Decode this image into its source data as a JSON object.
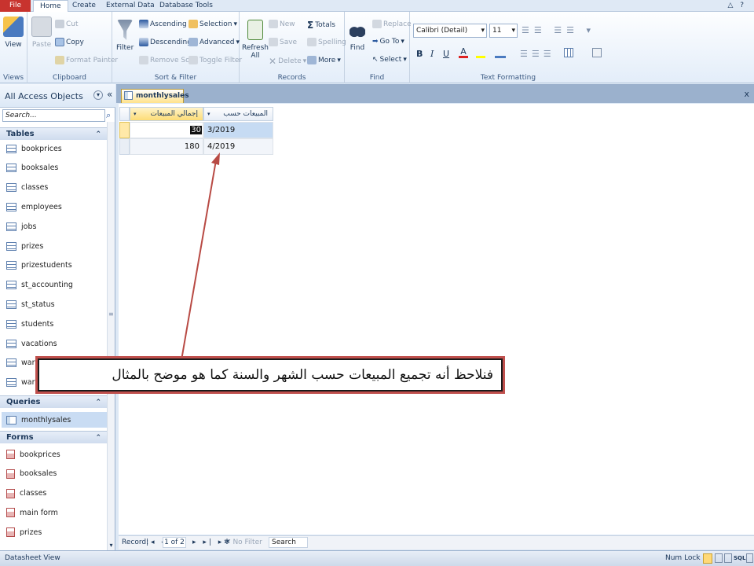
{
  "ribbon_tabs": [
    "File",
    "Home",
    "Create",
    "External Data",
    "Database Tools"
  ],
  "help_icons": "△ ?",
  "groups": {
    "views": {
      "label": "Views",
      "view": "View"
    },
    "clipboard": {
      "label": "Clipboard",
      "paste": "Paste",
      "cut": "Cut",
      "copy": "Copy",
      "format_painter": "Format Painter"
    },
    "sort_filter": {
      "label": "Sort & Filter",
      "filter": "Filter",
      "ascending": "Ascending",
      "descending": "Descending",
      "remove_sort": "Remove Sort",
      "selection": "Selection",
      "advanced": "Advanced",
      "toggle_filter": "Toggle Filter"
    },
    "records": {
      "label": "Records",
      "refresh": "Refresh All",
      "new": "New",
      "save": "Save",
      "delete": "Delete",
      "totals": "Totals",
      "spelling": "Spelling",
      "more": "More"
    },
    "find": {
      "label": "Find",
      "find": "Find",
      "replace": "Replace",
      "goto": "Go To",
      "select": "Select"
    },
    "text_formatting": {
      "label": "Text Formatting",
      "font": "Calibri (Detail)",
      "size": "11",
      "bold": "B",
      "italic": "I",
      "underline": "U"
    }
  },
  "nav": {
    "title": "All Access Objects",
    "search_placeholder": "Search...",
    "tables_label": "Tables",
    "tables": [
      "bookprices",
      "booksales",
      "classes",
      "employees",
      "jobs",
      "prizes",
      "prizestudents",
      "st_accounting",
      "st_status",
      "students",
      "vacations",
      "warr",
      "warr"
    ],
    "queries_label": "Queries",
    "queries": [
      "monthlysales"
    ],
    "forms_label": "Forms",
    "forms": [
      "bookprices",
      "booksales",
      "classes",
      "main form",
      "prizes"
    ]
  },
  "document": {
    "tab": "monthlysales",
    "close": "x",
    "columns": [
      "المبيعات حسب الشهر",
      "إجمالي المبيعات"
    ],
    "rows": [
      {
        "month": "3/2019",
        "total": "30"
      },
      {
        "month": "4/2019",
        "total": "180"
      }
    ]
  },
  "record_nav": {
    "label": "Record:",
    "position": "1 of 2",
    "no_filter": "No Filter",
    "search": "Search"
  },
  "status": {
    "left": "Datasheet View",
    "num_lock": "Num Lock"
  },
  "annotation": "فنلاحظ أنه تجميع المبيعات حسب الشهر والسنة كما هو موضح بالمثال"
}
